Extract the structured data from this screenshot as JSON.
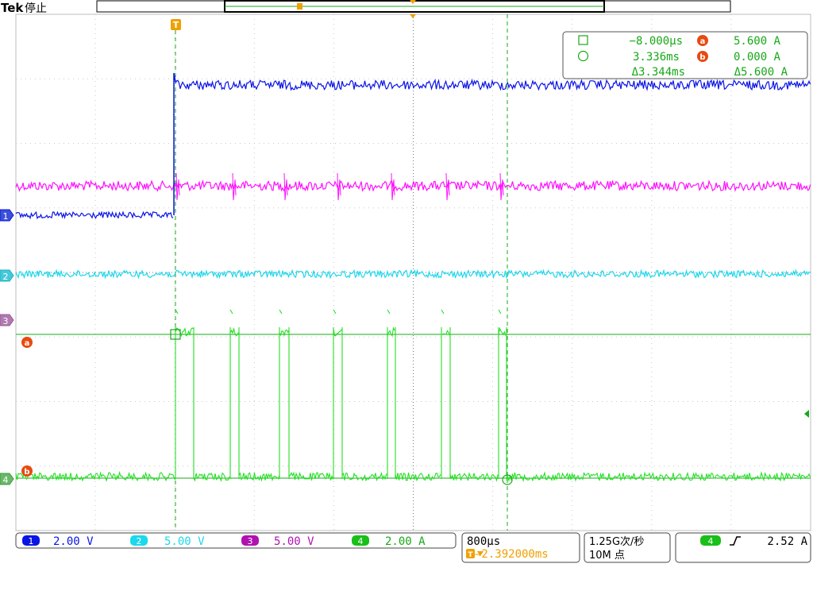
{
  "header": {
    "brand": "Tek",
    "state": "停止",
    "trigger_marker": "T"
  },
  "cursors": {
    "time_a": "−8.000µs",
    "time_b": "3.336ms",
    "delta_time": "Δ3.344ms",
    "label_a": "a",
    "label_b": "b",
    "val_a": "5.600 A",
    "val_b": "0.000 A",
    "delta_val": "Δ5.600 A"
  },
  "channel_markers": [
    "1",
    "2",
    "3",
    "4"
  ],
  "channels": [
    {
      "num": "1",
      "scale": "2.00 V",
      "color": "#0a14e6"
    },
    {
      "num": "2",
      "scale": "5.00 V",
      "color": "#1ad8ee"
    },
    {
      "num": "3",
      "scale": "5.00 V",
      "color": "#b012b0"
    },
    {
      "num": "4",
      "scale": "2.00 A",
      "color": "#18c018"
    }
  ],
  "timebase": {
    "scale": "800µs",
    "position": "→2.392000ms"
  },
  "acquisition": {
    "rate": "1.25G次/秒",
    "length": "10M 点"
  },
  "trigger": {
    "source": "4",
    "slope_icon": "rising-edge-icon",
    "level": "2.52 A"
  },
  "colors": {
    "ch1": "#0a14e6",
    "ch2": "#1ad8ee",
    "ch3": "#ff10ff",
    "ch4": "#22e022",
    "cursor": "#18a818",
    "trigger": "#f0a000",
    "cursor_label": "#e84a10"
  },
  "waveforms": {
    "ch1": {
      "level_before_trigger": "low",
      "level_after_trigger": "high"
    },
    "ch4": {
      "pulse_count": 7,
      "shape": "rectangular pulses with overshoot"
    }
  }
}
